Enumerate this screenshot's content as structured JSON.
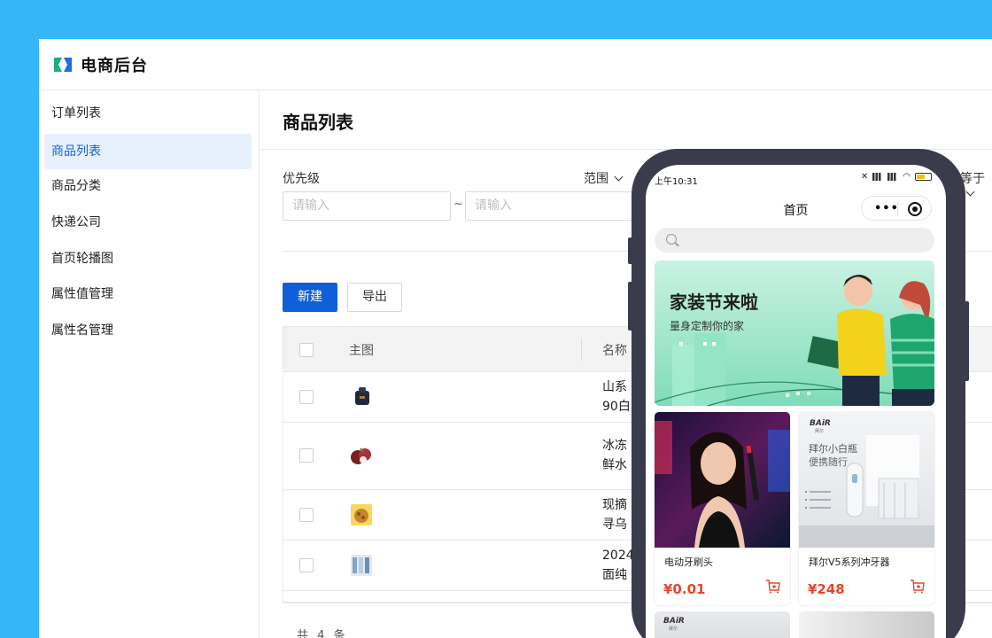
{
  "app": {
    "brand": "电商后台"
  },
  "sidebar": {
    "items": [
      {
        "label": "订单列表",
        "active": false
      },
      {
        "label": "商品列表",
        "active": true
      },
      {
        "label": "商品分类",
        "active": false
      },
      {
        "label": "快递公司",
        "active": false
      },
      {
        "label": "首页轮播图",
        "active": false
      },
      {
        "label": "属性值管理",
        "active": false
      },
      {
        "label": "属性名管理",
        "active": false
      }
    ]
  },
  "main": {
    "title": "商品列表",
    "filters": {
      "priority_label": "优先级",
      "priority_min_placeholder": "请输入",
      "priority_max_placeholder": "请输入",
      "range_select": "范围",
      "equals_select": "等于"
    },
    "toolbar": {
      "new_label": "新建",
      "export_label": "导出"
    },
    "table": {
      "headers": [
        "主图",
        "名称"
      ],
      "rows": [
        {
          "name_line1": "山系",
          "name_line2": "90白"
        },
        {
          "name_line1": "冰冻",
          "name_line2": "鲜水"
        },
        {
          "name_line1": "现摘",
          "name_line2": "寻乌"
        },
        {
          "name_line1": "2024",
          "name_line2": "面纯"
        }
      ]
    },
    "total": "共 4 条"
  },
  "phone": {
    "status_time": "上午10:31",
    "page_title": "首页",
    "capsule_more": "•••",
    "banner": {
      "title": "家装节来啦",
      "subtitle": "量身定制你的家"
    },
    "products": [
      {
        "name": "电动牙刷头",
        "price": "¥0.01"
      },
      {
        "name": "拜尔V5系列冲牙器",
        "price": "¥248",
        "image_brand": "BAiR",
        "image_brand_sub": "拜尔",
        "image_headline": "拜尔小白瓶",
        "image_tagline": "便携随行"
      }
    ],
    "more_cards": [
      {
        "image_brand": "BAiR",
        "image_brand_sub": "拜尔"
      }
    ]
  },
  "colors": {
    "background": "#35b6f8",
    "primary": "#0f5fd9",
    "active_nav_bg": "#e7f0fd",
    "price": "#e8452b"
  }
}
